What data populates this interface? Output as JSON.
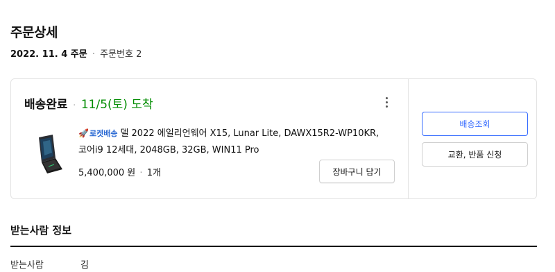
{
  "page": {
    "title": "주문상세"
  },
  "order": {
    "date": "2022. 11. 4 주문",
    "separator": "·",
    "number_label": "주문번호 2"
  },
  "shipment": {
    "status": "배송완료",
    "separator": "·",
    "arrival": "11/5(토) 도착",
    "product": {
      "badge_icon": "rocket-icon",
      "badge": "로켓배송",
      "name": "델 2022 에일리언웨어 X15, Lunar Lite, DAWX15R2-WP10KR, 코어i9 12세대, 2048GB, 32GB, WIN11 Pro",
      "price": "5,400,000 원",
      "separator": "·",
      "quantity": "1개"
    },
    "cart_button": "장바구니 담기",
    "track_button": "배송조회",
    "return_button": "교환, 반품 신청"
  },
  "recipient": {
    "section_title": "받는사람 정보",
    "name_label": "받는사람",
    "name_value": "김"
  },
  "colors": {
    "accent": "#346aff",
    "delivered": "#008c00",
    "rocket": "#2e6cd4"
  }
}
